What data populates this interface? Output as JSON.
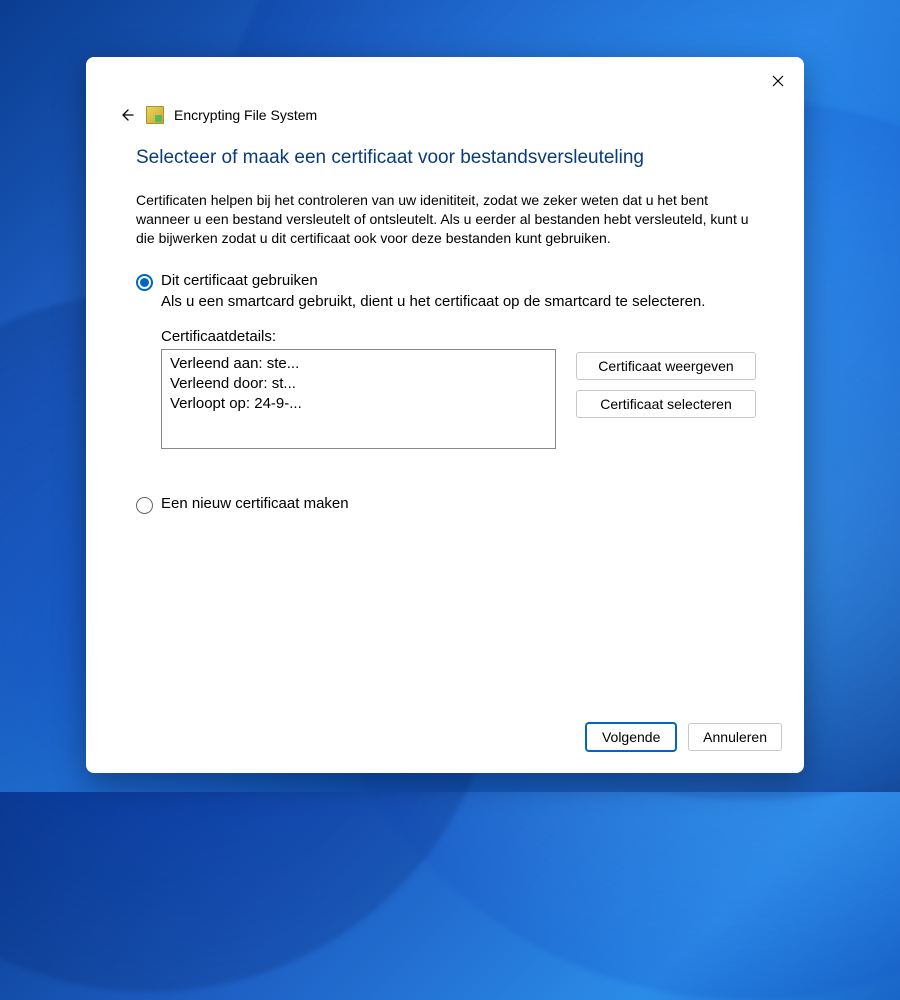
{
  "header": {
    "title": "Encrypting File System"
  },
  "content": {
    "heading": "Selecteer of maak een certificaat voor bestandsversleuteling",
    "description": "Certificaten helpen bij het controleren van uw idenititeit, zodat we zeker weten dat u het bent wanneer u een bestand versleutelt of ontsleutelt. Als u eerder al bestanden hebt versleuteld, kunt u die bijwerken zodat u dit certificaat ook voor deze bestanden kunt gebruiken.",
    "option_use": {
      "label": "Dit certificaat gebruiken",
      "sublabel": "Als u een smartcard gebruikt, dient u het certificaat op de smartcard te selecteren."
    },
    "details": {
      "label": "Certificaatdetails:",
      "line1": "Verleend aan: ste...",
      "line2": "Verleend door: st...",
      "line3": "Verloopt op: 24-9-..."
    },
    "buttons": {
      "view_cert": "Certificaat weergeven",
      "select_cert": "Certificaat selecteren"
    },
    "option_new": {
      "label": "Een nieuw certificaat maken"
    }
  },
  "footer": {
    "next": "Volgende",
    "cancel": "Annuleren"
  }
}
